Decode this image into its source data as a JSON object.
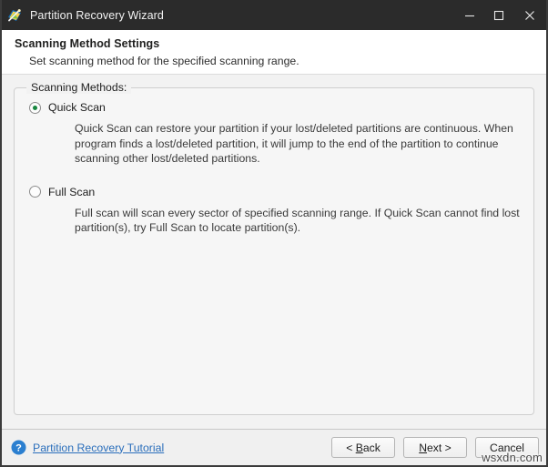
{
  "window": {
    "title": "Partition Recovery Wizard",
    "icon": "wizard-wand-icon",
    "controls": {
      "minimize": "minimize-icon",
      "maximize": "maximize-icon",
      "close": "close-icon"
    }
  },
  "header": {
    "title": "Scanning Method Settings",
    "subtitle": "Set scanning method for the specified scanning range."
  },
  "group": {
    "legend": "Scanning Methods:",
    "options": [
      {
        "label": "Quick Scan",
        "selected": true,
        "description": "Quick Scan can restore your partition if your lost/deleted partitions are continuous. When program finds a lost/deleted partition, it will jump to the end of the partition to continue scanning other lost/deleted partitions."
      },
      {
        "label": "Full Scan",
        "selected": false,
        "description": "Full scan will scan every sector of specified scanning range. If Quick Scan cannot find lost partition(s), try Full Scan to locate partition(s)."
      }
    ]
  },
  "footer": {
    "help_icon": "question-mark-icon",
    "tutorial_link": "Partition Recovery Tutorial",
    "buttons": {
      "back_pre": "< ",
      "back_accel": "B",
      "back_post": "ack",
      "next_pre": "",
      "next_accel": "N",
      "next_post": "ext >",
      "cancel": "Cancel"
    }
  },
  "watermark": "wsxdn.com",
  "colors": {
    "titlebar_bg": "#2b2b2b",
    "header_bg": "#ffffff",
    "body_bg": "#f2f2f2",
    "link": "#2a6ebb",
    "radio_dot": "#17863f",
    "help_blue": "#2b7fd0"
  }
}
